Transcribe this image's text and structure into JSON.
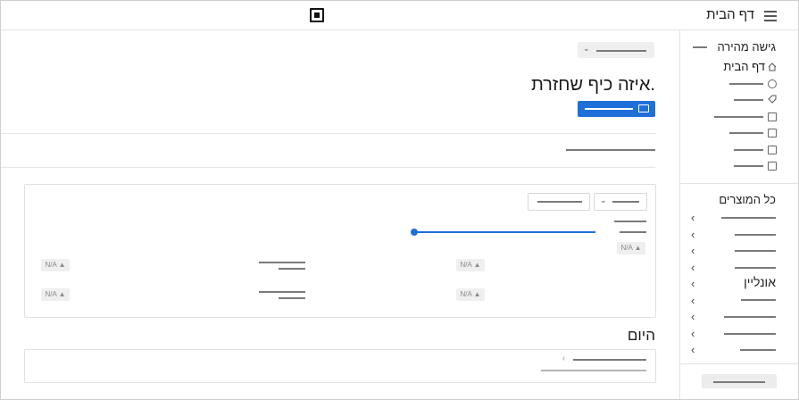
{
  "header": {
    "title": "דף הבית",
    "logo_icon": "square-logo-icon",
    "menu_icon": "hamburger-menu-icon"
  },
  "sidebar": {
    "quick_access_heading": "גישה מהירה",
    "home_label": "דף הבית",
    "quick_icons": [
      "globe-icon",
      "tag-icon",
      "dollar-icon",
      "invoice-icon",
      "chart-icon",
      "cash-icon"
    ],
    "all_products_heading": "כל המוצרים",
    "online_label": "אונליין"
  },
  "main": {
    "headline": ".איזה כיף שחזרת",
    "accent_color": "#1f6fd9",
    "today_heading": "היום",
    "na_labels": [
      "N/A",
      "N/A",
      "N/A",
      "N/A",
      "N/A"
    ]
  }
}
